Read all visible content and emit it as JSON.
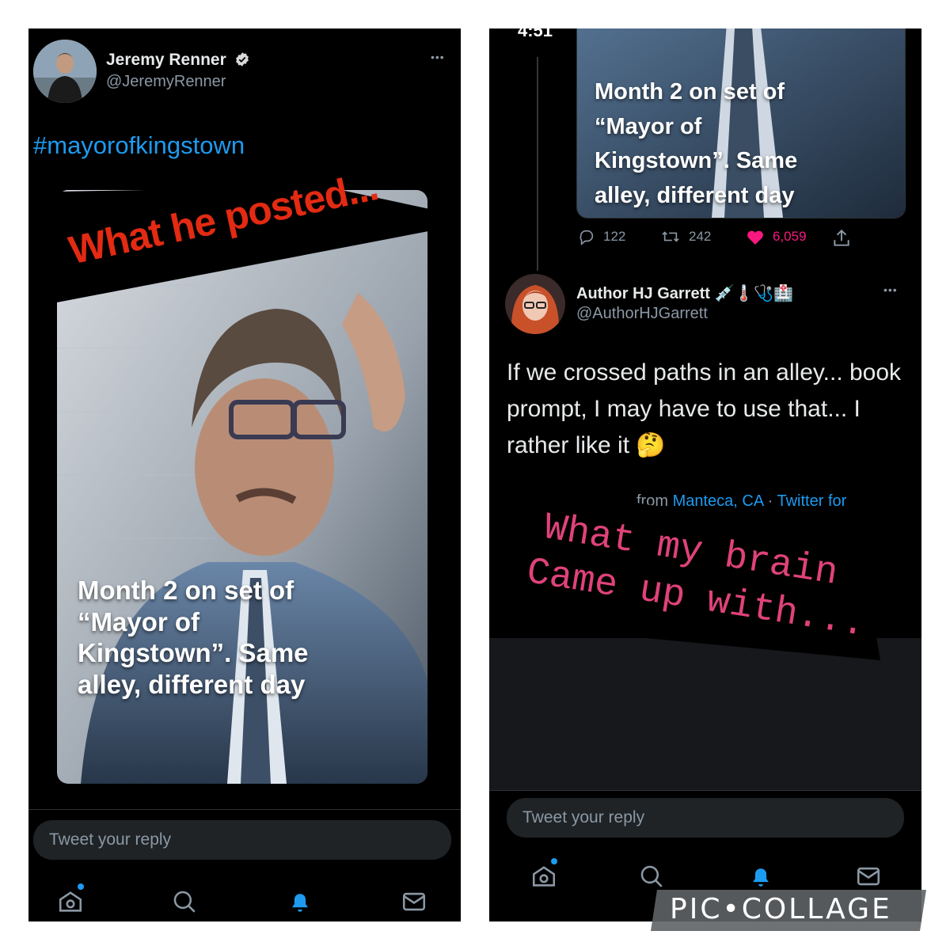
{
  "left": {
    "author": {
      "name": "Jeremy Renner",
      "handle": "@JeremyRenner",
      "verified": true
    },
    "more_label": "•••",
    "hashtag": "#mayorofkingstown",
    "photo_caption": "Month 2 on set of\n“Mayor of\nKingstown”.  Same\nalley, different day",
    "banner_text": "What he posted...",
    "reply_placeholder": "Tweet your reply"
  },
  "right": {
    "status_time": "4:51",
    "photo_caption": "Month 2 on set of\n“Mayor of\nKingstown”.  Same\nalley, different day",
    "stats": {
      "replies": "122",
      "retweets": "242",
      "likes": "6,059"
    },
    "reply": {
      "name": "Author HJ Garrett",
      "name_emojis": "💉🌡️🩺🏥",
      "handle": "@AuthorHJGarrett",
      "text": "If we crossed paths in an alley... book prompt, I may have to use that... I rather like it",
      "thinking_emoji": "🤔",
      "meta_partial": "from",
      "meta_location": "Manteca, CA",
      "meta_client": "Twitter for"
    },
    "sticker_text_line1": "What my brain",
    "sticker_text_line2": "Came up with...",
    "reply_placeholder": "Tweet your reply",
    "watermark": "PIC•COLLAGE"
  },
  "colors": {
    "background": "#000000",
    "accent_blue": "#1d9bf0",
    "like_pink": "#f91880",
    "banner_red": "#e32a12",
    "sticker_pink": "#e0427a"
  },
  "icons": [
    "verified-badge-icon",
    "more-icon",
    "home-icon",
    "search-icon",
    "bell-icon",
    "mail-icon",
    "reply-icon",
    "retweet-icon",
    "like-icon",
    "share-icon",
    "signal-icon",
    "wifi-icon",
    "battery-icon"
  ]
}
